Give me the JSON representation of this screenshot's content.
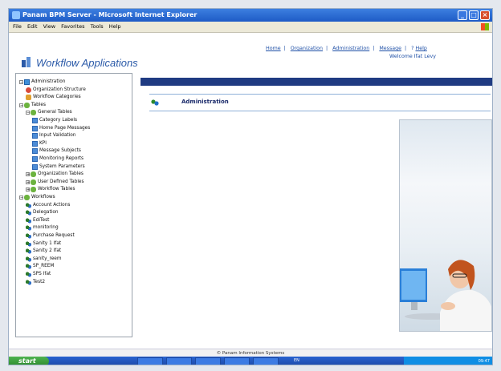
{
  "window": {
    "title": "Panam BPM Server - Microsoft Internet Explorer"
  },
  "menu": [
    "File",
    "Edit",
    "View",
    "Favorites",
    "Tools",
    "Help"
  ],
  "app": {
    "name": "Workflow Applications"
  },
  "top_links": [
    "Home",
    "Organization",
    "Administration",
    "Message",
    "Help"
  ],
  "welcome": "Welcome Ifat Levy",
  "tree": [
    {
      "label": "Administration",
      "icon": "db",
      "pm": "−"
    },
    {
      "label": "Organization Structure",
      "icon": "red"
    },
    {
      "label": "Workflow Categories",
      "icon": "org"
    },
    {
      "label": "Tables",
      "icon": "fold",
      "pm": "−"
    },
    {
      "label": "General Tables",
      "icon": "fold",
      "pm": "−"
    },
    {
      "label": "Category Labels",
      "icon": "tbl"
    },
    {
      "label": "Home Page Messages",
      "icon": "tbl"
    },
    {
      "label": "Input Validation",
      "icon": "tbl"
    },
    {
      "label": "KPI",
      "icon": "tbl"
    },
    {
      "label": "Message Subjects",
      "icon": "tbl"
    },
    {
      "label": "Monitoring Reports",
      "icon": "tbl"
    },
    {
      "label": "System Parameters",
      "icon": "tbl"
    },
    {
      "label": "Organization Tables",
      "icon": "fold",
      "pm": "+"
    },
    {
      "label": "User Defined Tables",
      "icon": "fold",
      "pm": "+"
    },
    {
      "label": "Workflow Tables",
      "icon": "fold",
      "pm": "+"
    },
    {
      "label": "Workflows",
      "icon": "fold",
      "pm": "−"
    },
    {
      "label": "Account Actions",
      "icon": "wf"
    },
    {
      "label": "Delegation",
      "icon": "wf"
    },
    {
      "label": "EdiTest",
      "icon": "wf"
    },
    {
      "label": "monitoring",
      "icon": "wf"
    },
    {
      "label": "Purchase Request",
      "icon": "wf"
    },
    {
      "label": "Sanity 1 Ifat",
      "icon": "wf"
    },
    {
      "label": "Sanity 2 Ifat",
      "icon": "wf"
    },
    {
      "label": "sanity_reem",
      "icon": "wf"
    },
    {
      "label": "SP_REEM",
      "icon": "wf"
    },
    {
      "label": "SPS Ifat",
      "icon": "wf"
    },
    {
      "label": "Test2",
      "icon": "wf"
    }
  ],
  "section": {
    "title": "Administration"
  },
  "footer": "© Panam Information Systems",
  "taskbar": {
    "start": "start",
    "lang": "EN",
    "clock": "09:47"
  },
  "colors": {
    "accent": "#1f3b82",
    "link": "#1e4fa6",
    "titlebar": "#1e5bc6"
  }
}
